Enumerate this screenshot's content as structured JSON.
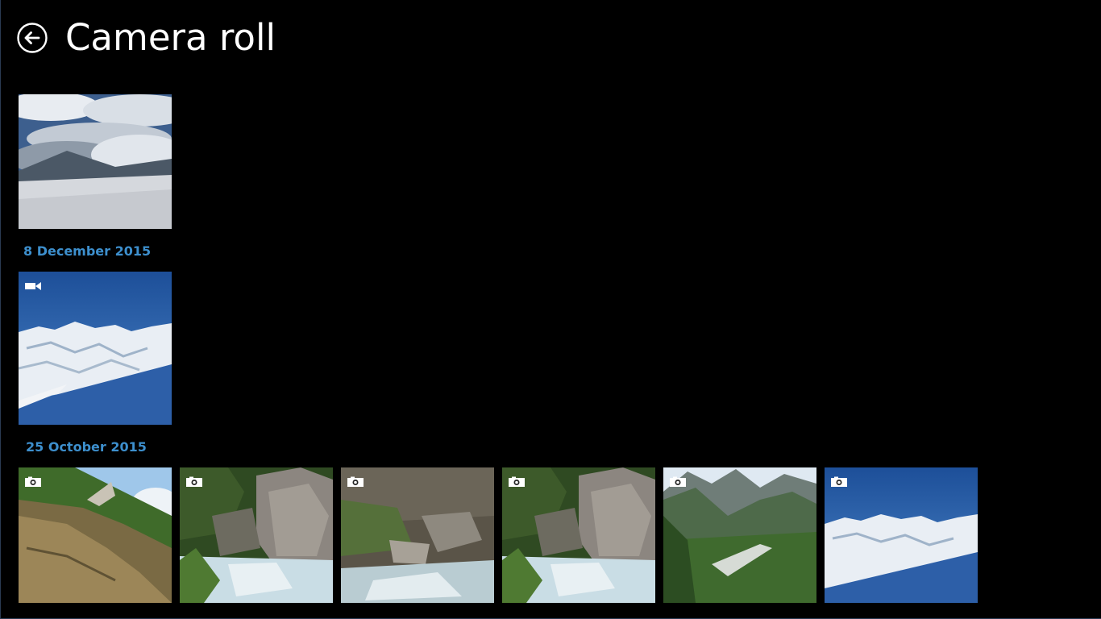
{
  "header": {
    "title": "Camera roll",
    "back_icon": "back-arrow-circle-icon"
  },
  "groups": [
    {
      "date": "",
      "items": [
        {
          "type": "photo",
          "badge": null,
          "scene": "cloudy-snow-slope"
        }
      ]
    },
    {
      "date": "8 December 2015",
      "items": [
        {
          "type": "video",
          "badge": "video-camera-icon",
          "scene": "snowy-mountains-blue-sky"
        }
      ]
    },
    {
      "date": "25 October 2015",
      "items": [
        {
          "type": "photo",
          "badge": "camera-icon",
          "scene": "rocky-cliff-trees"
        },
        {
          "type": "photo",
          "badge": "camera-icon",
          "scene": "waterfall-river-rocks"
        },
        {
          "type": "photo",
          "badge": "camera-icon",
          "scene": "boulders-stream"
        },
        {
          "type": "photo",
          "badge": "camera-icon",
          "scene": "waterfall-river-rocks"
        },
        {
          "type": "photo",
          "badge": "camera-icon",
          "scene": "green-mountain-valley"
        },
        {
          "type": "photo",
          "badge": "camera-icon",
          "scene": "snowy-mountains-blue-sky"
        }
      ]
    }
  ],
  "colors": {
    "background": "#000000",
    "accent": "#3d8fcd",
    "title": "#ffffff"
  }
}
